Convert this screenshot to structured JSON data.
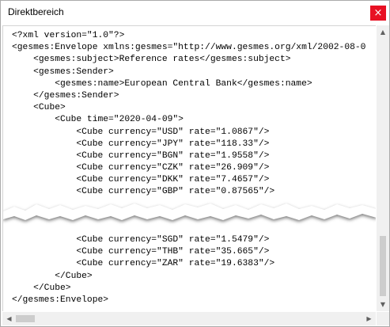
{
  "window": {
    "title": "Direktbereich",
    "close_glyph": "×"
  },
  "code_top": [
    "<?xml version=\"1.0\"?>",
    "<gesmes:Envelope xmlns:gesmes=\"http://www.gesmes.org/xml/2002-08-0",
    "    <gesmes:subject>Reference rates</gesmes:subject>",
    "    <gesmes:Sender>",
    "        <gesmes:name>European Central Bank</gesmes:name>",
    "    </gesmes:Sender>",
    "    <Cube>",
    "        <Cube time=\"2020-04-09\">",
    "            <Cube currency=\"USD\" rate=\"1.0867\"/>",
    "            <Cube currency=\"JPY\" rate=\"118.33\"/>",
    "            <Cube currency=\"BGN\" rate=\"1.9558\"/>",
    "            <Cube currency=\"CZK\" rate=\"26.909\"/>",
    "            <Cube currency=\"DKK\" rate=\"7.4657\"/>",
    "            <Cube currency=\"GBP\" rate=\"0.87565\"/>"
  ],
  "code_bottom": [
    "            <Cube currency=\"SGD\" rate=\"1.5479\"/>",
    "            <Cube currency=\"THB\" rate=\"35.665\"/>",
    "            <Cube currency=\"ZAR\" rate=\"19.6383\"/>",
    "        </Cube>",
    "    </Cube>",
    "</gesmes:Envelope>"
  ],
  "scrollbars": {
    "up_icon": "▲",
    "down_icon": "▼",
    "left_icon": "◀",
    "right_icon": "▶"
  },
  "colors": {
    "close_button": "#e81123",
    "scrollbar_track": "#f0f0f0",
    "scrollbar_thumb": "#cdcdcd"
  }
}
